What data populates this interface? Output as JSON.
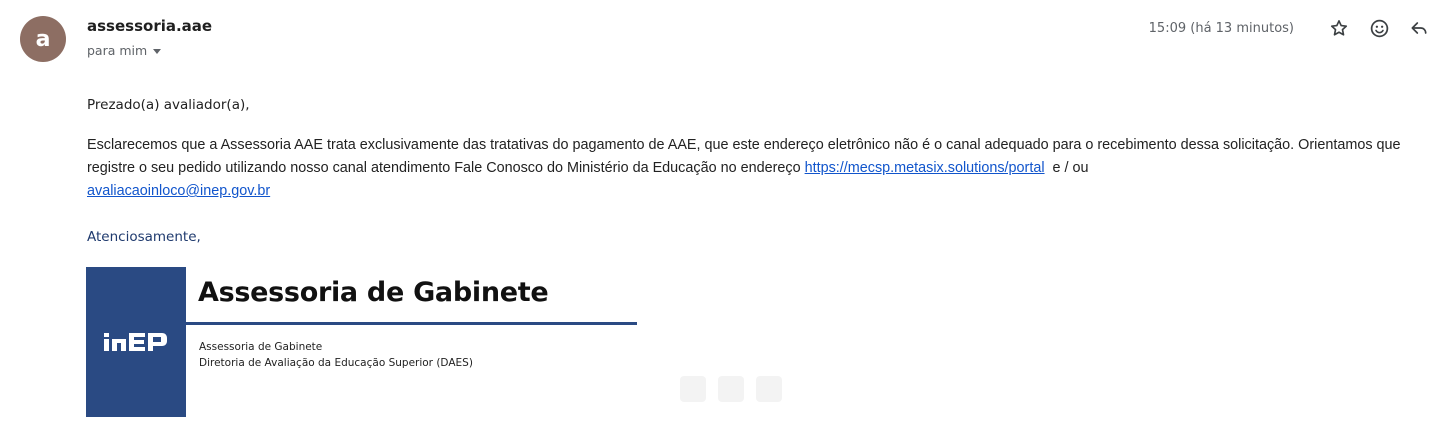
{
  "header": {
    "avatar_letter": "a",
    "sender_name": "assessoria.aae",
    "recipients_label": "para mim",
    "timestamp": "15:09 (há 13 minutos)",
    "icons": [
      "star-icon",
      "emoji-icon",
      "reply-icon"
    ]
  },
  "body": {
    "greeting": "Prezado(a) avaliador(a),",
    "paragraph_part1": "Esclarecemos que a Assessoria AAE trata exclusivamente das tratativas do pagamento de AAE, que este endereço eletrônico não é o canal adequado para o recebimento dessa solicitação. Orientamos que registre o seu pedido utilizando nosso canal atendimento Fale Conosco do Ministério da Educação no endereço ",
    "link1": "https://mecsp.metasix.solutions/portal",
    "paragraph_part2": "  e / ou ",
    "link2": "avaliacaoinloco@inep.gov.br",
    "closing": "Atenciosamente,"
  },
  "signature": {
    "logo_text": "inep",
    "title": "Assessoria de Gabinete",
    "line1": "Assessoria de Gabinete",
    "line2": "Diretoria de Avaliação da Educação Superior (DAES)",
    "brand_color": "#2a4a83"
  },
  "colors": {
    "avatar_bg": "#8d6e63",
    "link": "#1155cc",
    "muted": "#5f6368"
  }
}
